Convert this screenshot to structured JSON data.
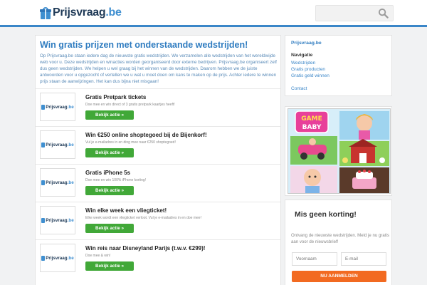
{
  "header": {
    "logo_name": "Prijsvraag",
    "logo_tld": ".be",
    "search_placeholder": ""
  },
  "main": {
    "title": "Win gratis prijzen met onderstaande wedstrijden!",
    "intro": "Op Prijsvraag.be staan iedere dag de nieuwste gratis wedstrijden. We verzamelen alle wedstrijden van het wereldwijde web voor u. Deze wedstrijden en winacties worden georganiseerd door externe bedrijven. Prijsvraag.be organiseert zelf dus geen wedstrijden. We helpen u wel graag bij het winnen van de wedstrijden. Daarom hebben we de juiste antwoorden voor u opgezocht of vertellen we u wat u moet doen om kans te maken op de prijs. Achter iedere te winnen prijs staan de aanwijzingen. Het kan dus bijna niet misgaan!",
    "contests": [
      {
        "title": "Gratis Pretpark tickets",
        "desc": "Doe mee en win direct of 3 gratis pretpark kaartjes heeft!",
        "button": "Bekijk actie »"
      },
      {
        "title": "Win €250 online shoptegoed bij de Bijenkorf!",
        "desc": "Vul je e-mailadres in en ding mee naar €250 shoptegoed!",
        "button": "Bekijk actie »"
      },
      {
        "title": "Gratis iPhone 5s",
        "desc": "Doe mee en win 100% iPhone korting!",
        "button": "Bekijk actie »"
      },
      {
        "title": "Win elke week een vliegticket!",
        "desc": "Elke week wordt een vliegticket verloot. Vul je e-mailadres in en doe mee!",
        "button": "Bekijk actie »"
      },
      {
        "title": "Win reis naar Disneyland Parijs (t.w.v. €299)!",
        "desc": "Doe mee & win!",
        "button": "Bekijk actie »"
      }
    ]
  },
  "sidebar": {
    "brand": "Prijsvraag.be",
    "nav_title": "Navigatie",
    "links": [
      "Wedstrijden",
      "Gratis producten",
      "Gratis geld winnen",
      "Contact"
    ],
    "ad": {
      "title_line1": "GAME",
      "title_line2": "BABY"
    },
    "newsletter": {
      "title": "Mis geen korting!",
      "text": "Ontvang de nieuwste wedstrijden. Meld je nu gratis aan voor de nieuwsbrief!",
      "firstname_placeholder": "Voornaam",
      "email_placeholder": "E-mail",
      "button": "NU AANMELDEN"
    }
  },
  "colors": {
    "accent": "#3a86c8",
    "button_green": "#41a838",
    "button_orange": "#f26a21"
  }
}
